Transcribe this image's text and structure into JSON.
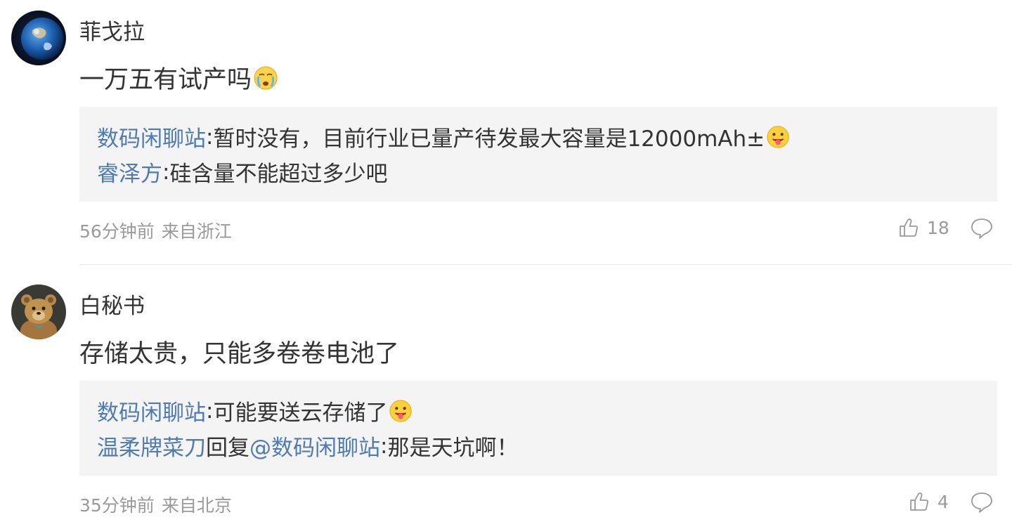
{
  "comments": [
    {
      "username": "菲戈拉",
      "avatar": "earth-avatar",
      "text": "一万五有试产吗",
      "text_emoji": "crying-emoji",
      "replies": [
        {
          "author": "数码闲聊站",
          "sep": ":",
          "text": "暂时没有，目前行业已量产待发最大容量是12000mAh±",
          "emoji": "tongue-emoji"
        },
        {
          "author": "睿泽方",
          "sep": ":",
          "text": "硅含量不能超过多少吧"
        }
      ],
      "time": "56分钟前",
      "location": "来自浙江",
      "likes": "18"
    },
    {
      "username": "白秘书",
      "avatar": "teddy-bear-avatar",
      "text": "存储太贵，只能多卷卷电池了",
      "replies": [
        {
          "author": "数码闲聊站",
          "sep": ":",
          "text": "可能要送云存储了",
          "emoji": "tongue-emoji"
        },
        {
          "author": "温柔牌菜刀",
          "mid": "回复",
          "mention": "@数码闲聊站",
          "sep": ":",
          "text": "那是天坑啊！"
        }
      ],
      "time": "35分钟前",
      "location": "来自北京",
      "likes": "4"
    }
  ],
  "colors": {
    "link": "#4f7bb0",
    "text": "#333333",
    "meta": "#9a9a9a",
    "reply_bg": "#f4f4f4"
  }
}
